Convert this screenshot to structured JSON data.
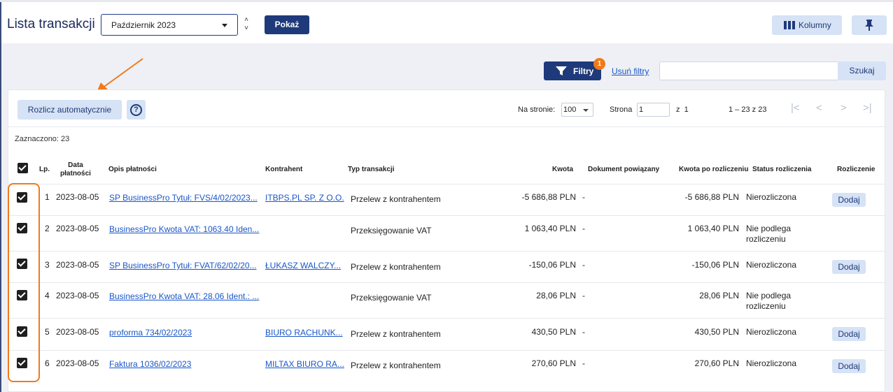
{
  "header": {
    "title": "Lista transakcji",
    "month": "Październik 2023",
    "show_label": "Pokaż",
    "columns_label": "Kolumny"
  },
  "filters": {
    "filters_label": "Filtry",
    "active_count": "1",
    "clear_label": "Usuń filtry",
    "search_value": "",
    "search_label": "Szukaj"
  },
  "toolbar": {
    "auto_settle_label": "Rozlicz automatycznie",
    "help_symbol": "?",
    "per_page_label": "Na stronie:",
    "per_page_value": "100",
    "page_label": "Strona",
    "page_value": "1",
    "page_of": "z  1",
    "range_label": "1 – 23 z 23",
    "nav": [
      "|<",
      "<",
      ">",
      ">|"
    ]
  },
  "selected_label": "Zaznaczono: 23",
  "table": {
    "columns": {
      "lp": "Lp.",
      "date_l1": "Data",
      "date_l2": "płatności",
      "desc": "Opis płatności",
      "contractor": "Kontrahent",
      "type": "Typ transakcji",
      "amount": "Kwota",
      "doc": "Dokument powiązany",
      "amount_after": "Kwota po rozliczeniu",
      "status": "Status rozliczenia",
      "settle": "Rozliczenie"
    },
    "rows": [
      {
        "lp": "1",
        "date": "2023-08-05",
        "desc": "SP BusinessPro Tytuł: FVS/4/02/2023...",
        "contractor": "ITBPS.PL SP. Z O.O.",
        "type": "Przelew z kontrahentem",
        "amount": "-5 686,88 PLN",
        "doc": "-",
        "amount_after": "-5 686,88 PLN",
        "status_l1": "Nierozliczona",
        "status_l2": "",
        "action": "Dodaj"
      },
      {
        "lp": "2",
        "date": "2023-08-05",
        "desc": "BusinessPro Kwota VAT: 1063.40 Iden...",
        "contractor": "",
        "type": "Przeksięgowanie VAT",
        "amount": "1 063,40 PLN",
        "doc": "-",
        "amount_after": "1 063,40 PLN",
        "status_l1": "Nie podlega",
        "status_l2": "rozliczeniu",
        "action": ""
      },
      {
        "lp": "3",
        "date": "2023-08-05",
        "desc": "SP BusinessPro Tytuł: FVAT/62/02/20...",
        "contractor": "ŁUKASZ WALCZY...",
        "type": "Przelew z kontrahentem",
        "amount": "-150,06 PLN",
        "doc": "-",
        "amount_after": "-150,06 PLN",
        "status_l1": "Nierozliczona",
        "status_l2": "",
        "action": "Dodaj"
      },
      {
        "lp": "4",
        "date": "2023-08-05",
        "desc": "BusinessPro Kwota VAT: 28.06 Ident.: ...",
        "contractor": "",
        "type": "Przeksięgowanie VAT",
        "amount": "28,06 PLN",
        "doc": "-",
        "amount_after": "28,06 PLN",
        "status_l1": "Nie podlega",
        "status_l2": "rozliczeniu",
        "action": ""
      },
      {
        "lp": "5",
        "date": "2023-08-05",
        "desc": "proforma 734/02/2023",
        "contractor": "BIURO RACHUNK...",
        "type": "Przelew z kontrahentem",
        "amount": "430,50 PLN",
        "doc": "-",
        "amount_after": "430,50 PLN",
        "status_l1": "Nierozliczona",
        "status_l2": "",
        "action": "Dodaj"
      },
      {
        "lp": "6",
        "date": "2023-08-05",
        "desc": "Faktura 1036/02/2023",
        "contractor": "MILTAX BIURO RA...",
        "type": "Przelew z kontrahentem",
        "amount": "270,60 PLN",
        "doc": "-",
        "amount_after": "270,60 PLN",
        "status_l1": "Nierozliczona",
        "status_l2": "",
        "action": "Dodaj"
      }
    ]
  },
  "colors": {
    "primary": "#1e3a7a",
    "light_button": "#d6e2f5",
    "link": "#1a56c8",
    "accent_orange": "#f07a1a",
    "background": "#eef0f5"
  }
}
